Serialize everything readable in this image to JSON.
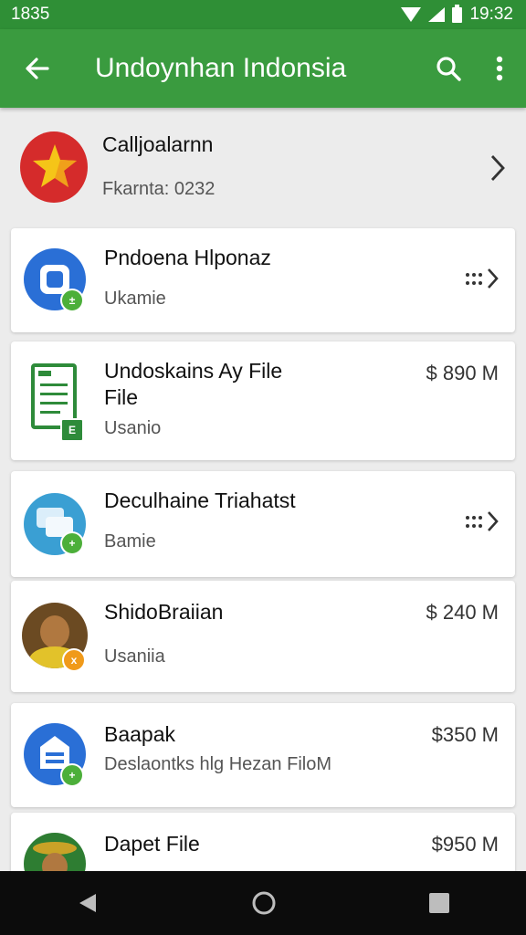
{
  "status": {
    "left": "1835",
    "time": "19:32"
  },
  "appbar": {
    "title": "Undoynhan Indonsia"
  },
  "header": {
    "name": "Calljoalarnn",
    "sub": "Fkarnta: 0232"
  },
  "items": [
    {
      "name": "Pndoena Hlponaz",
      "sub": "Ukamie",
      "price": "",
      "badge": "±"
    },
    {
      "name": "Undoskains Ay File\nFile",
      "sub": "Usanio",
      "price": "$ 890 M",
      "badge": "E"
    },
    {
      "name": "Deculhaine Triahatst",
      "sub": "Bamie",
      "price": "",
      "badge": "+"
    },
    {
      "name": "ShidoBraiian",
      "sub": "Usaniia",
      "price": "$ 240 M",
      "badge": "x"
    },
    {
      "name": "Baapak",
      "sub": "Deslaontks hlg Hezan FiloM",
      "price": "$350 M",
      "badge": "+"
    },
    {
      "name": "Dapet File",
      "sub": "",
      "price": "$950 M",
      "badge": ""
    }
  ],
  "colors": {
    "primary": "#3a9b3f",
    "status": "#2f8f36",
    "blue": "#2a6fd6",
    "badge_green": "#4caf3a",
    "badge_orange": "#f09a1a"
  },
  "icons": [
    "back-arrow-icon",
    "search-icon",
    "more-vert-icon",
    "chevron-right-icon",
    "dotted-chevron-icon"
  ]
}
